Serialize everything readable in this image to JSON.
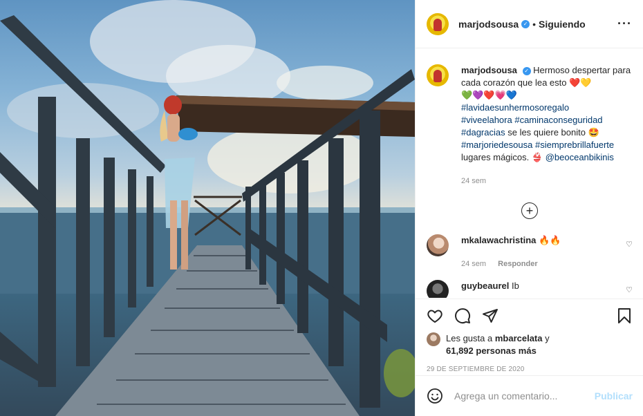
{
  "post": {
    "username": "marjodsousa",
    "follow_status": "Siguiendo",
    "separator": "•"
  },
  "caption": {
    "username": "marjodsousa",
    "text_line1": "Hermoso despertar para cada corazón que lea esto",
    "hearts_line1": "❤️💛",
    "hearts_line2": "💚💜❤️💗💙",
    "hashtags": [
      "#lavidaesunhermosoregalo",
      "#viveelahora",
      "#caminaconseguridad",
      "#dagracias"
    ],
    "text_after_dagracias": " se les quiere bonito 🤩",
    "hashtags2": [
      "#marjoriedesousa",
      "#siemprebrillafuerte"
    ],
    "text_end": "lugares mágicos. 👙",
    "mention": "@beoceanbikinis",
    "time": "24 sem"
  },
  "comments": [
    {
      "username": "mkalawachristina",
      "text": "🔥🔥",
      "time": "24 sem",
      "reply": "Responder"
    },
    {
      "username": "guybeaurel",
      "text": "Ib",
      "time": "",
      "reply": ""
    }
  ],
  "likes": {
    "prefix": "Les gusta a",
    "liker": "mbarcelata",
    "connector": "y",
    "count": "61,892 personas más"
  },
  "date": "29 DE SEPTIEMBRE DE 2020",
  "composer": {
    "placeholder": "Agrega un comentario...",
    "publish": "Publicar"
  },
  "icons": {
    "more": "more-horizontal-icon",
    "like": "heart-icon",
    "comment": "comment-bubble-icon",
    "share": "paper-plane-icon",
    "save": "bookmark-icon",
    "emoji": "smiley-icon",
    "load_more": "plus-circle-icon"
  },
  "colors": {
    "link": "#00376b",
    "verified": "#3897f0",
    "muted": "#8e8e8e",
    "publish_disabled": "#b2dffc"
  }
}
